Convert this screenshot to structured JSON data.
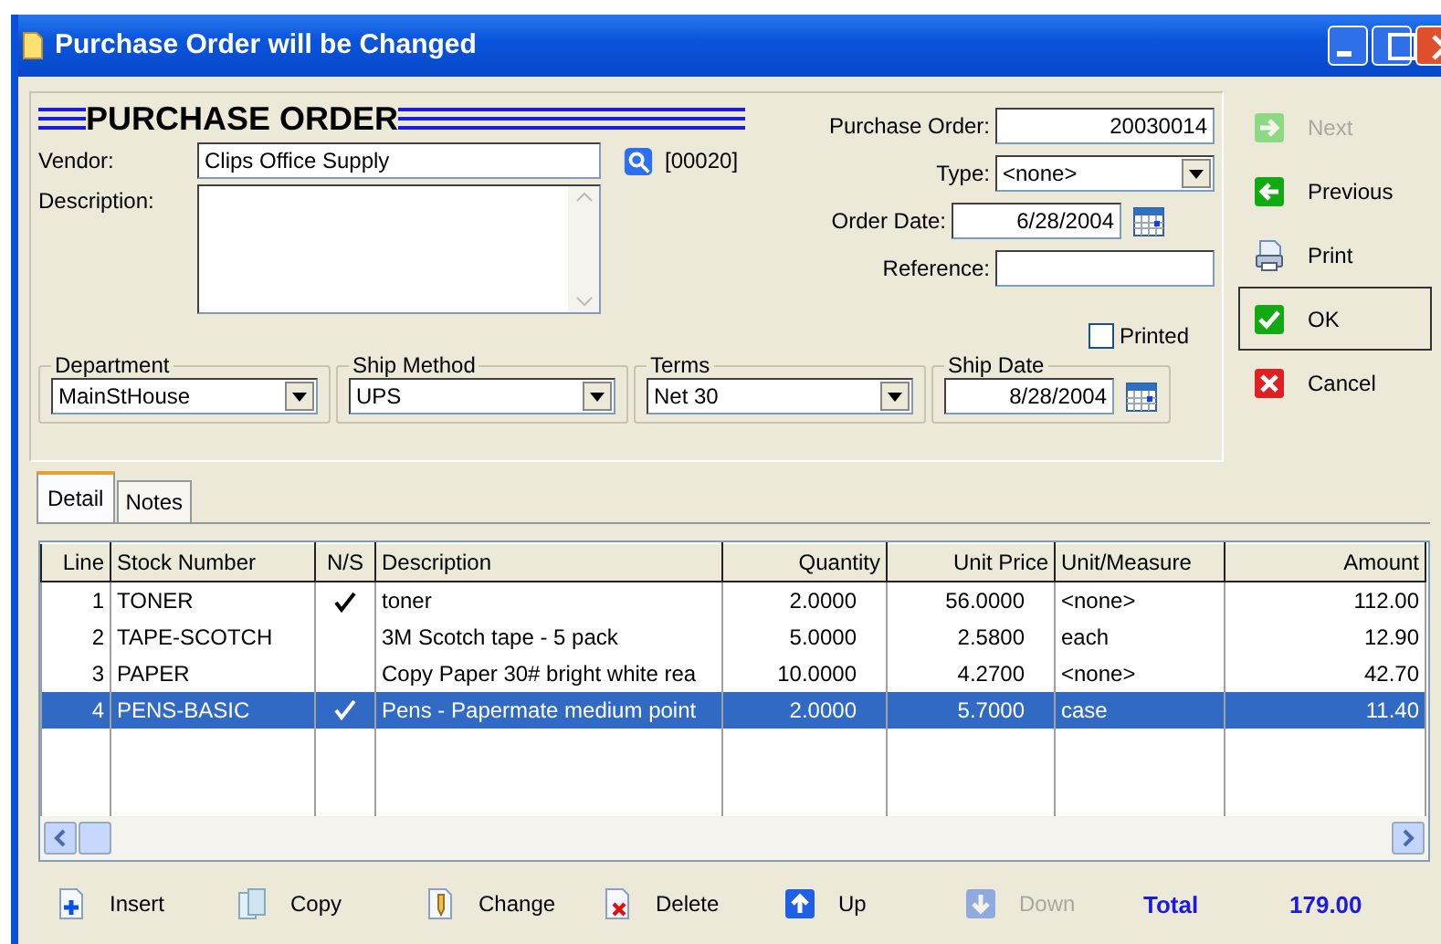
{
  "window": {
    "title": "Purchase Order will be Changed"
  },
  "header": {
    "title": "PURCHASE ORDER"
  },
  "vendor": {
    "label": "Vendor:",
    "value": "Clips Office Supply",
    "code": "[00020]"
  },
  "description": {
    "label": "Description:"
  },
  "order_fields": [
    {
      "label": "Purchase Order:",
      "value": "20030014",
      "kind": "number"
    },
    {
      "label": "Type:",
      "value": "<none>",
      "kind": "select"
    },
    {
      "label": "Order Date:",
      "value": "6/28/2004",
      "kind": "date"
    },
    {
      "label": "Reference:",
      "kind": "text"
    }
  ],
  "printed": {
    "label": "Printed",
    "checked": false
  },
  "groups": [
    {
      "label": "Department",
      "value": "MainStHouse",
      "kind": "select"
    },
    {
      "label": "Ship Method",
      "value": "UPS",
      "kind": "select"
    },
    {
      "label": "Terms",
      "value": "Net 30",
      "kind": "select"
    },
    {
      "label": "Ship Date",
      "value": "8/28/2004",
      "kind": "date"
    }
  ],
  "actions": [
    {
      "label": "Next",
      "disabled": true,
      "focused": false
    },
    {
      "label": "Previous",
      "disabled": false,
      "focused": false
    },
    {
      "label": "Print",
      "disabled": false,
      "focused": false
    },
    {
      "label": "OK",
      "disabled": false,
      "focused": true
    },
    {
      "label": "Cancel",
      "disabled": false,
      "focused": false
    }
  ],
  "tabs": [
    {
      "label": "Detail",
      "selected": true
    },
    {
      "label": "Notes",
      "selected": false
    }
  ],
  "table": {
    "columns": [
      {
        "label": "Line"
      },
      {
        "label": "Stock Number"
      },
      {
        "label": "N/S"
      },
      {
        "label": "Description"
      },
      {
        "label": "Quantity"
      },
      {
        "label": "Unit Price"
      },
      {
        "label": "Unit/Measure"
      },
      {
        "label": "Amount"
      }
    ],
    "rows": [
      {
        "line": "1",
        "stock": "TONER",
        "ns": true,
        "description": "toner",
        "quantity": "2.0000",
        "unit_price": "56.0000",
        "unit": "<none>",
        "amount": "112.00",
        "selected": false
      },
      {
        "line": "2",
        "stock": "TAPE-SCOTCH",
        "ns": false,
        "description": "3M Scotch tape - 5 pack",
        "quantity": "5.0000",
        "unit_price": "2.5800",
        "unit": "each",
        "amount": "12.90",
        "selected": false
      },
      {
        "line": "3",
        "stock": "PAPER",
        "ns": false,
        "description": "Copy Paper 30# bright white rea",
        "quantity": "10.0000",
        "unit_price": "4.2700",
        "unit": "<none>",
        "amount": "42.70",
        "selected": false
      },
      {
        "line": "4",
        "stock": "PENS-BASIC",
        "ns": true,
        "description": "Pens - Papermate medium point",
        "quantity": "2.0000",
        "unit_price": "5.7000",
        "unit": "case",
        "amount": "11.40",
        "selected": true
      }
    ]
  },
  "toolbar": [
    {
      "label": "Insert",
      "disabled": false
    },
    {
      "label": "Copy",
      "disabled": false
    },
    {
      "label": "Change",
      "disabled": false
    },
    {
      "label": "Delete",
      "disabled": false
    },
    {
      "label": "Up",
      "disabled": false
    },
    {
      "label": "Down",
      "disabled": true
    }
  ],
  "total": {
    "label": "Total",
    "value": "179.00"
  }
}
